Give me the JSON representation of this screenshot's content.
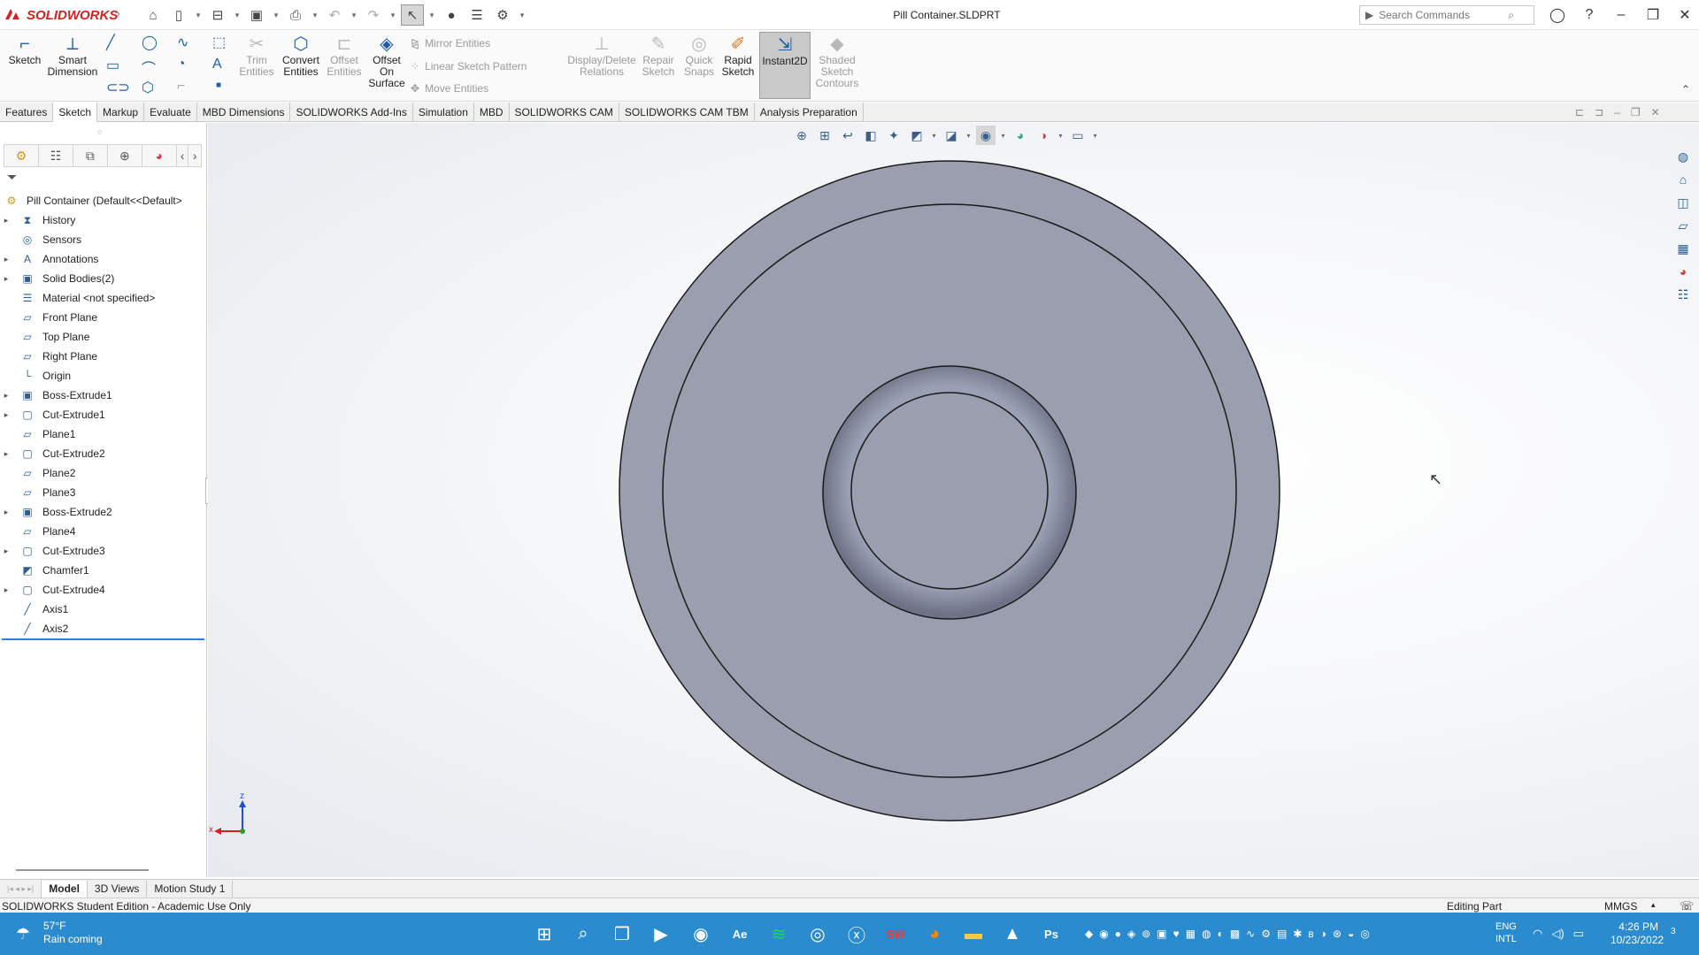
{
  "app": {
    "logo_text": "SOLIDWORKS",
    "window_title": "Pill Container.SLDPRT",
    "search_placeholder": "Search Commands"
  },
  "ribbon": {
    "sketch": "Sketch",
    "smart_dimension": "Smart Dimension",
    "trim_entities": "Trim Entities",
    "convert_entities": "Convert Entities",
    "offset_entities": "Offset Entities",
    "offset_on_surface": "Offset On Surface",
    "mirror_entities": "Mirror Entities",
    "linear_sketch_pattern": "Linear Sketch Pattern",
    "move_entities": "Move Entities",
    "display_delete_relations": "Display/Delete Relations",
    "repair_sketch": "Repair Sketch",
    "quick_snaps": "Quick Snaps",
    "rapid_sketch": "Rapid Sketch",
    "instant2d": "Instant2D",
    "shaded_sketch_contours": "Shaded Sketch Contours"
  },
  "tabs": [
    "Features",
    "Sketch",
    "Markup",
    "Evaluate",
    "MBD Dimensions",
    "SOLIDWORKS Add-Ins",
    "Simulation",
    "MBD",
    "SOLIDWORKS CAM",
    "SOLIDWORKS CAM TBM",
    "Analysis Preparation"
  ],
  "active_tab": "Sketch",
  "tree": {
    "root": "Pill Container  (Default<<Default>",
    "items": [
      {
        "label": "History",
        "expandable": true,
        "icon": "history-icon"
      },
      {
        "label": "Sensors",
        "expandable": false,
        "icon": "sensors-icon"
      },
      {
        "label": "Annotations",
        "expandable": true,
        "icon": "annotations-icon"
      },
      {
        "label": "Solid Bodies(2)",
        "expandable": true,
        "icon": "solid-bodies-icon"
      },
      {
        "label": "Material <not specified>",
        "expandable": false,
        "icon": "material-icon"
      },
      {
        "label": "Front Plane",
        "expandable": false,
        "icon": "plane-icon"
      },
      {
        "label": "Top Plane",
        "expandable": false,
        "icon": "plane-icon"
      },
      {
        "label": "Right Plane",
        "expandable": false,
        "icon": "plane-icon"
      },
      {
        "label": "Origin",
        "expandable": false,
        "icon": "origin-icon"
      },
      {
        "label": "Boss-Extrude1",
        "expandable": true,
        "icon": "boss-extrude-icon"
      },
      {
        "label": "Cut-Extrude1",
        "expandable": true,
        "icon": "cut-extrude-icon"
      },
      {
        "label": "Plane1",
        "expandable": false,
        "icon": "plane-icon"
      },
      {
        "label": "Cut-Extrude2",
        "expandable": true,
        "icon": "cut-extrude-icon"
      },
      {
        "label": "Plane2",
        "expandable": false,
        "icon": "plane-icon"
      },
      {
        "label": "Plane3",
        "expandable": false,
        "icon": "plane-icon"
      },
      {
        "label": "Boss-Extrude2",
        "expandable": true,
        "icon": "boss-extrude-icon"
      },
      {
        "label": "Plane4",
        "expandable": false,
        "icon": "plane-icon"
      },
      {
        "label": "Cut-Extrude3",
        "expandable": true,
        "icon": "cut-extrude-icon"
      },
      {
        "label": "Chamfer1",
        "expandable": false,
        "icon": "chamfer-icon"
      },
      {
        "label": "Cut-Extrude4",
        "expandable": true,
        "icon": "cut-extrude-icon"
      },
      {
        "label": "Axis1",
        "expandable": false,
        "icon": "axis-icon"
      },
      {
        "label": "Axis2",
        "expandable": false,
        "icon": "axis-icon"
      }
    ]
  },
  "bottom_tabs": [
    "Model",
    "3D Views",
    "Motion Study 1"
  ],
  "status": {
    "left": "SOLIDWORKS Student Edition - Academic Use Only",
    "editing": "Editing Part",
    "units": "MMGS"
  },
  "triad": {
    "z": "z",
    "x": "x"
  },
  "taskbar": {
    "weather_temp": "57°F",
    "weather_desc": "Rain coming",
    "lang_1": "ENG",
    "lang_2": "INTL",
    "time": "4:26 PM",
    "date": "10/23/2022",
    "notif_count": "3"
  },
  "colors": {
    "part": "#9a9dad",
    "accent": "#1f5fa6",
    "taskbar": "#2a8ccf"
  }
}
